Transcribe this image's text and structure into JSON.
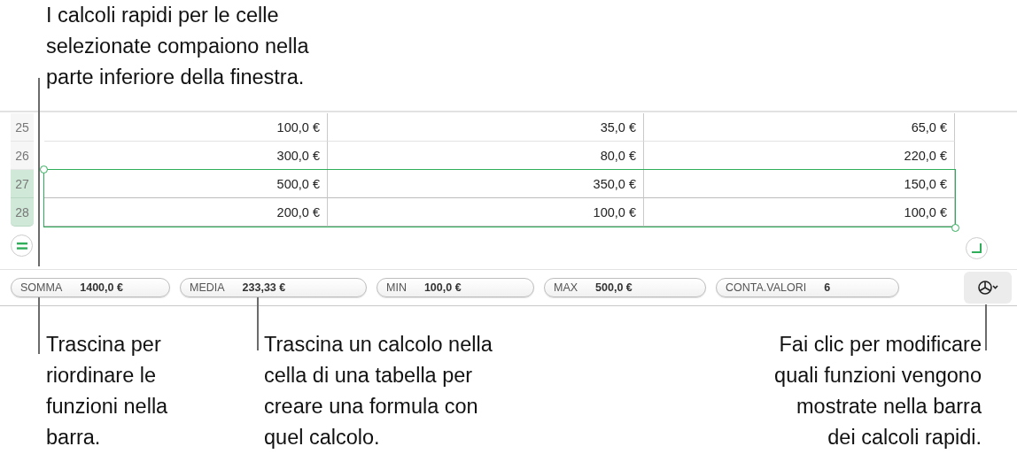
{
  "top_callout": "I calcoli rapidi per le celle\nselezionate compaiono nella\nparte inferiore della finestra.",
  "table": {
    "rows": [
      {
        "number": "25",
        "selected": false,
        "cells": [
          "100,0 €",
          "35,0 €",
          "65,0 €"
        ]
      },
      {
        "number": "26",
        "selected": false,
        "cells": [
          "300,0 €",
          "80,0 €",
          "220,0 €"
        ]
      },
      {
        "number": "27",
        "selected": true,
        "cells": [
          "500,0 €",
          "350,0 €",
          "150,0 €"
        ]
      },
      {
        "number": "28",
        "selected": true,
        "cells": [
          "200,0 €",
          "100,0 €",
          "100,0 €"
        ]
      }
    ]
  },
  "quick_calcs": [
    {
      "label": "SOMMA",
      "value": "1400,0 €"
    },
    {
      "label": "MEDIA",
      "value": "233,33 €"
    },
    {
      "label": "MIN",
      "value": "100,0 €"
    },
    {
      "label": "MAX",
      "value": "500,0 €"
    },
    {
      "label": "CONTA.VALORI",
      "value": "6"
    }
  ],
  "bottom_callouts": [
    {
      "text": "Trascina per\nriordinare le\nfunzioni nella\nbarra."
    },
    {
      "text": "Trascina un calcolo nella\ncella di una tabella per\ncreare una formula con\nquel calcolo."
    },
    {
      "text": "Fai clic per modificare\nquali funzioni vengono\nmostrate nella barra\ndei calcoli rapidi."
    }
  ]
}
